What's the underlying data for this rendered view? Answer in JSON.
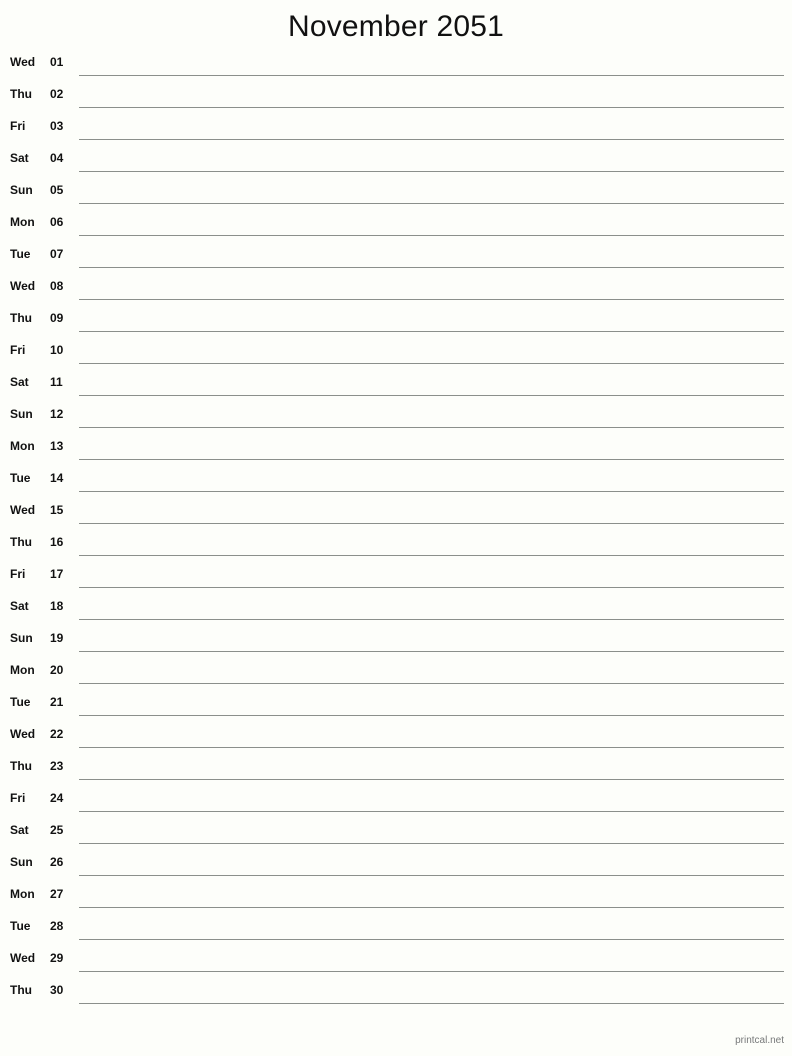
{
  "document": {
    "title": "November 2051",
    "month": "November",
    "year": "2051",
    "background_color": "#fdfefa",
    "rule_color": "#8b8f8b",
    "text_color": "#111111"
  },
  "footer": {
    "brand": "printcal.net",
    "color": "#77797a"
  },
  "days": [
    {
      "weekday": "Wed",
      "date": "01"
    },
    {
      "weekday": "Thu",
      "date": "02"
    },
    {
      "weekday": "Fri",
      "date": "03"
    },
    {
      "weekday": "Sat",
      "date": "04"
    },
    {
      "weekday": "Sun",
      "date": "05"
    },
    {
      "weekday": "Mon",
      "date": "06"
    },
    {
      "weekday": "Tue",
      "date": "07"
    },
    {
      "weekday": "Wed",
      "date": "08"
    },
    {
      "weekday": "Thu",
      "date": "09"
    },
    {
      "weekday": "Fri",
      "date": "10"
    },
    {
      "weekday": "Sat",
      "date": "11"
    },
    {
      "weekday": "Sun",
      "date": "12"
    },
    {
      "weekday": "Mon",
      "date": "13"
    },
    {
      "weekday": "Tue",
      "date": "14"
    },
    {
      "weekday": "Wed",
      "date": "15"
    },
    {
      "weekday": "Thu",
      "date": "16"
    },
    {
      "weekday": "Fri",
      "date": "17"
    },
    {
      "weekday": "Sat",
      "date": "18"
    },
    {
      "weekday": "Sun",
      "date": "19"
    },
    {
      "weekday": "Mon",
      "date": "20"
    },
    {
      "weekday": "Tue",
      "date": "21"
    },
    {
      "weekday": "Wed",
      "date": "22"
    },
    {
      "weekday": "Thu",
      "date": "23"
    },
    {
      "weekday": "Fri",
      "date": "24"
    },
    {
      "weekday": "Sat",
      "date": "25"
    },
    {
      "weekday": "Sun",
      "date": "26"
    },
    {
      "weekday": "Mon",
      "date": "27"
    },
    {
      "weekday": "Tue",
      "date": "28"
    },
    {
      "weekday": "Wed",
      "date": "29"
    },
    {
      "weekday": "Thu",
      "date": "30"
    }
  ]
}
